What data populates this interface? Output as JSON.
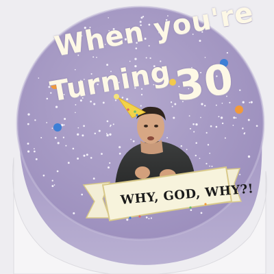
{
  "cake": {
    "line1": "When you're",
    "line2": "Turning",
    "line3": "30",
    "banner": "WHY, GOD, WHY?!"
  },
  "colors": {
    "background": "#eeedf1",
    "frosting": "#a99cc6",
    "piping": "#fdf8e6",
    "banner": "#f7f3dc",
    "banner_border": "#d8c98a",
    "party_hat": "#f2d24a"
  },
  "decor": {
    "sprinkle_colors": [
      "#f29a3a",
      "#3d7fd6",
      "#f2c94c",
      "#e06666",
      "#6cc06c"
    ]
  }
}
